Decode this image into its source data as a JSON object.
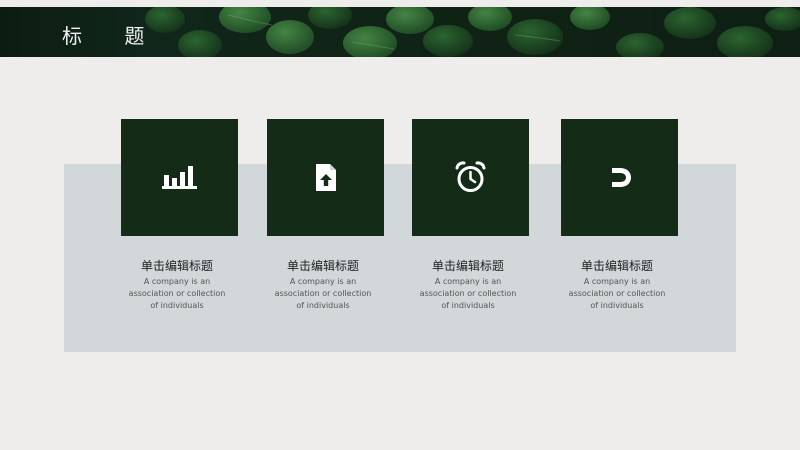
{
  "header": {
    "title": "标 题"
  },
  "features": [
    {
      "icon": "bar-chart-icon",
      "title": "单击编辑标题",
      "description": "A company is an association or collection of individuals"
    },
    {
      "icon": "document-upload-icon",
      "title": "单击编辑标题",
      "description": "A company is an association or collection of individuals"
    },
    {
      "icon": "alarm-clock-icon",
      "title": "单击编辑标题",
      "description": "A company is an association or collection of individuals"
    },
    {
      "icon": "magnet-icon",
      "title": "单击编辑标题",
      "description": "A company is an association or collection of individuals"
    }
  ],
  "colors": {
    "background": "#eeedeb",
    "header": "#0e1f12",
    "card": "#132b17",
    "panel": "#d2d7da",
    "icon": "#ffffff"
  }
}
